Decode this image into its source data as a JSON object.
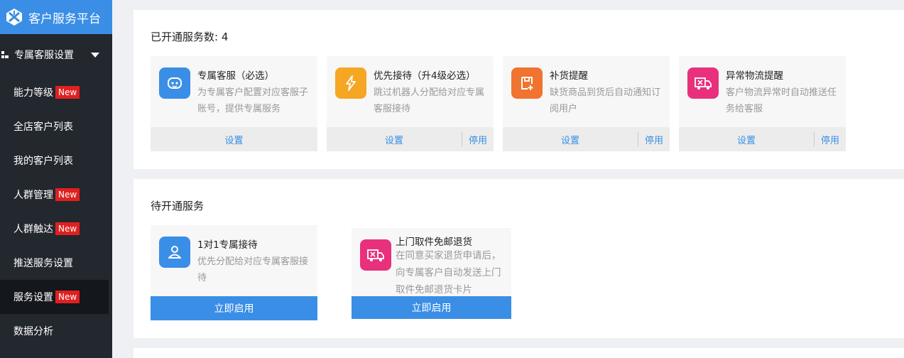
{
  "sidebar": {
    "brand_title": "客户服务平台",
    "group_label": "专属客服设置",
    "items": [
      {
        "label": "能力等级",
        "badge": "New"
      },
      {
        "label": "全店客户列表"
      },
      {
        "label": "我的客户列表"
      },
      {
        "label": "人群管理",
        "badge": "New"
      },
      {
        "label": "人群触达",
        "badge": "New"
      },
      {
        "label": "推送服务设置"
      },
      {
        "label": "服务设置",
        "badge": "New",
        "active": true
      },
      {
        "label": "数据分析"
      }
    ]
  },
  "opened": {
    "title": "已开通服务数: 4",
    "cards": [
      {
        "title": "专属客服（必选）",
        "desc": "为专属客户配置对应客服子账号，提供专属服务",
        "icon": "bot-face-icon",
        "color": "#3a8ee6",
        "set_label": "设置"
      },
      {
        "title": "优先接待（升4级必选）",
        "desc": "跳过机器人分配给对应专属客服接待",
        "icon": "lightning-icon",
        "color": "#f5a623",
        "set_label": "设置",
        "stop_label": "停用"
      },
      {
        "title": "补货提醒",
        "desc": "缺货商品到货后自动通知订阅用户",
        "icon": "restock-icon",
        "color": "#f0732f",
        "set_label": "设置",
        "stop_label": "停用"
      },
      {
        "title": "异常物流提醒",
        "desc": "客户物流异常时自动推送任务给客服",
        "icon": "truck-icon",
        "color": "#e8307d",
        "set_label": "设置",
        "stop_label": "停用"
      }
    ]
  },
  "pending": {
    "title": "待开通服务",
    "cards": [
      {
        "title": "1对1专属接待",
        "desc": "优先分配给对应专属客服接待",
        "icon": "user-icon",
        "color": "#3a8ee6",
        "action_label": "立即启用"
      },
      {
        "title": "上门取件免邮退货",
        "desc": "在同意买家退货申请后，向专属客户自动发送上门取件免邮退货卡片",
        "icon": "truck-return-icon",
        "color": "#e8307d",
        "action_label": "立即启用"
      }
    ]
  }
}
